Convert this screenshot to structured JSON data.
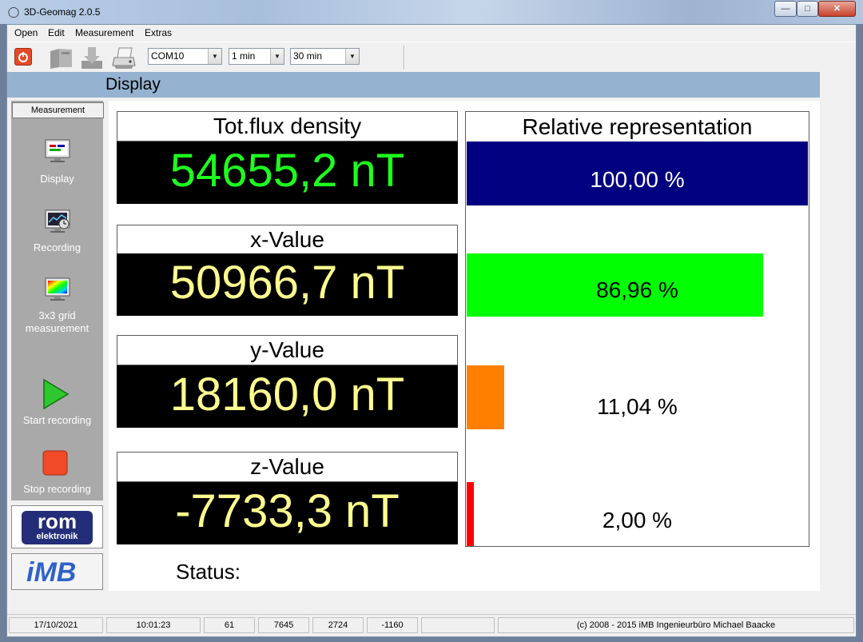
{
  "window": {
    "title": "3D-Geomag 2.0.5"
  },
  "menu": {
    "items": [
      "Open",
      "Edit",
      "Measurement",
      "Extras"
    ]
  },
  "toolbar": {
    "port": "COM10",
    "interval": "1 min",
    "duration": "30 min"
  },
  "header": {
    "title": "Display"
  },
  "sidebar": {
    "header": "Measurement",
    "items": [
      {
        "label": "Display"
      },
      {
        "label": "Recording"
      },
      {
        "label_line1": "3x3 grid",
        "label_line2": "measurement"
      },
      {
        "label": "Start recording"
      },
      {
        "label": "Stop recording"
      }
    ],
    "logo1_top": "rom",
    "logo1_bottom": "elektronik",
    "logo2": "iMB"
  },
  "values": [
    {
      "label": "Tot.flux density",
      "value": "54655,2 nT"
    },
    {
      "label": "x-Value",
      "value": "50966,7 nT"
    },
    {
      "label": "y-Value",
      "value": "18160,0 nT"
    },
    {
      "label": "z-Value",
      "value": "-7733,3 nT"
    }
  ],
  "relative": {
    "title": "Relative representation",
    "bars": [
      {
        "text": "100,00 %",
        "fraction": 1.0,
        "color": "#000080",
        "text_color": "#ffffff"
      },
      {
        "text": "86,96 %",
        "fraction": 0.8696,
        "color": "#00ff00",
        "text_color": "#000000"
      },
      {
        "text": "11,04 %",
        "fraction": 0.1104,
        "color": "#ff8000",
        "text_color": "#000000"
      },
      {
        "text": "2,00 %",
        "fraction": 0.02,
        "color": "#ff0000",
        "text_color": "#000000"
      }
    ]
  },
  "status": {
    "label": "Status:"
  },
  "statusbar": {
    "date": "17/10/2021",
    "time": "10:01:23",
    "count": "61",
    "x": "7645",
    "y": "2724",
    "z": "-1160",
    "copyright": "(c) 2008  - 2015 iMB  Ingenieurbüro Michael Baacke"
  }
}
